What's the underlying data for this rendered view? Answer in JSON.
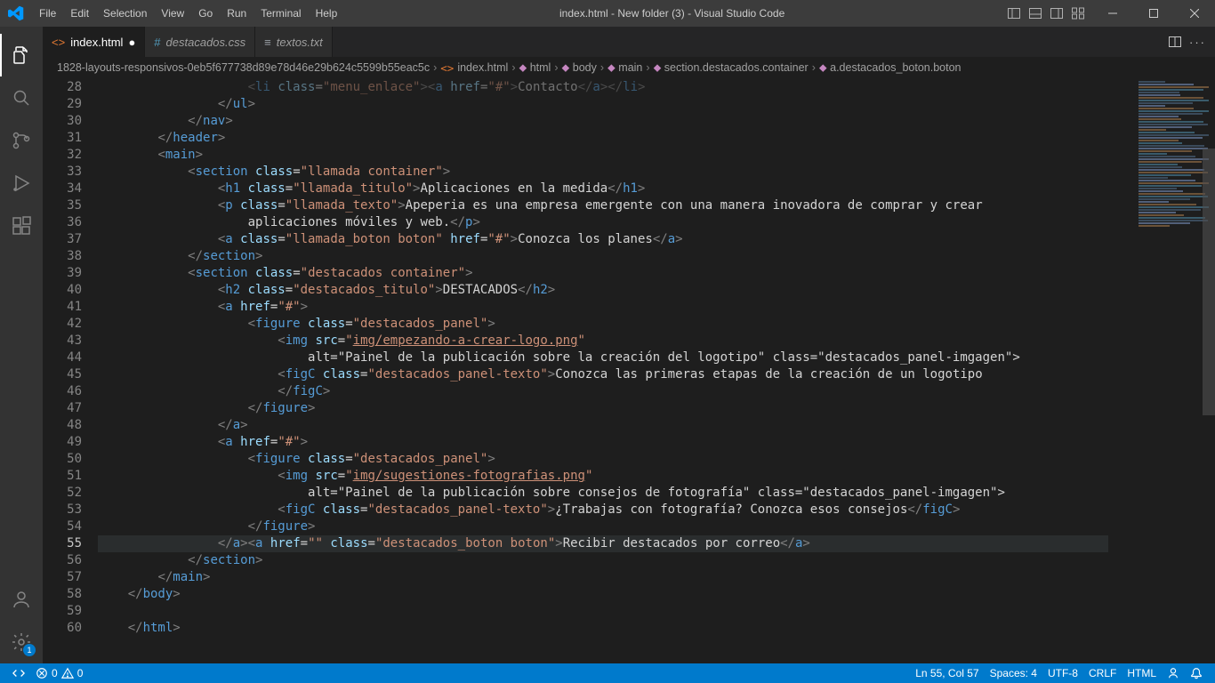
{
  "titlebar": {
    "menu": [
      "File",
      "Edit",
      "Selection",
      "View",
      "Go",
      "Run",
      "Terminal",
      "Help"
    ],
    "title": "index.html - New folder (3) - Visual Studio Code"
  },
  "tabs": [
    {
      "icon": "html",
      "label": "index.html",
      "active": true,
      "dirty": true
    },
    {
      "icon": "css",
      "label": "destacados.css",
      "active": false,
      "dirty": false
    },
    {
      "icon": "txt",
      "label": "textos.txt",
      "active": false,
      "dirty": false
    }
  ],
  "breadcrumb": {
    "folder": "1828-layouts-responsivos-0eb5f677738d89e78d46e29b624c5599b55eac5c",
    "file": "index.html",
    "path": [
      "html",
      "body",
      "main",
      "section.destacados.container",
      "a.destacados_boton.boton"
    ]
  },
  "gutter": {
    "start": 28,
    "end": 60,
    "highlight": 55
  },
  "code_lines": [
    {
      "n": 28,
      "indent": 20,
      "raw": "<li class=\"menu_enlace\"><a href=\"#\">Contacto</a></li>",
      "fade": true
    },
    {
      "n": 29,
      "indent": 16,
      "raw": "</ul>"
    },
    {
      "n": 30,
      "indent": 12,
      "raw": "</nav>"
    },
    {
      "n": 31,
      "indent": 8,
      "raw": "</header>"
    },
    {
      "n": 32,
      "indent": 8,
      "raw": "<main>"
    },
    {
      "n": 33,
      "indent": 12,
      "raw": "<section class=\"llamada container\">"
    },
    {
      "n": 34,
      "indent": 16,
      "raw": "<h1 class=\"llamada_titulo\">Aplicaciones en la medida</h1>"
    },
    {
      "n": 35,
      "indent": 16,
      "raw": "<p class=\"llamada_texto\">Apeperia es una empresa emergente con una manera inovadora de comprar y crear"
    },
    {
      "n": 36,
      "indent": 20,
      "raw": "aplicaciones móviles y web.</p>"
    },
    {
      "n": 37,
      "indent": 16,
      "raw": "<a class=\"llamada_boton boton\" href=\"#\">Conozca los planes</a>"
    },
    {
      "n": 38,
      "indent": 12,
      "raw": "</section>"
    },
    {
      "n": 39,
      "indent": 12,
      "raw": "<section class=\"destacados container\">"
    },
    {
      "n": 40,
      "indent": 16,
      "raw": "<h2 class=\"destacados_titulo\">DESTACADOS</h2>"
    },
    {
      "n": 41,
      "indent": 16,
      "raw": "<a href=\"#\">"
    },
    {
      "n": 42,
      "indent": 20,
      "raw": "<figure class=\"destacados_panel\">"
    },
    {
      "n": 43,
      "indent": 24,
      "raw": "<img src=\"img/empezando-a-crear-logo.png\"",
      "link": "img/empezando-a-crear-logo.png"
    },
    {
      "n": 44,
      "indent": 28,
      "raw": "alt=\"Painel de la publicación sobre la creación del logotipo\" class=\"destacados_panel-imgagen\">"
    },
    {
      "n": 45,
      "indent": 24,
      "raw": "<figC class=\"destacados_panel-texto\">Conozca las primeras etapas de la creación de un logotipo"
    },
    {
      "n": 46,
      "indent": 24,
      "raw": "</figC>"
    },
    {
      "n": 47,
      "indent": 20,
      "raw": "</figure>"
    },
    {
      "n": 48,
      "indent": 16,
      "raw": "</a>"
    },
    {
      "n": 49,
      "indent": 16,
      "raw": "<a href=\"#\">"
    },
    {
      "n": 50,
      "indent": 20,
      "raw": "<figure class=\"destacados_panel\">"
    },
    {
      "n": 51,
      "indent": 24,
      "raw": "<img src=\"img/sugestiones-fotografias.png\"",
      "link": "img/sugestiones-fotografias.png"
    },
    {
      "n": 52,
      "indent": 28,
      "raw": "alt=\"Painel de la publicación sobre consejos de fotografía\" class=\"destacados_panel-imgagen\">"
    },
    {
      "n": 53,
      "indent": 24,
      "raw": "<figC class=\"destacados_panel-texto\">¿Trabajas con fotografía? Conozca esos consejos</figC>"
    },
    {
      "n": 54,
      "indent": 20,
      "raw": "</figure>"
    },
    {
      "n": 55,
      "indent": 16,
      "raw": "</a><a href=\"\" class=\"destacados_boton boton\">Recibir destacados por correo</a>",
      "hl": true
    },
    {
      "n": 56,
      "indent": 12,
      "raw": "</section>"
    },
    {
      "n": 57,
      "indent": 8,
      "raw": "</main>"
    },
    {
      "n": 58,
      "indent": 4,
      "raw": "</body>"
    },
    {
      "n": 59,
      "indent": 0,
      "raw": ""
    },
    {
      "n": 60,
      "indent": 4,
      "raw": "</html>"
    }
  ],
  "status": {
    "errors": "0",
    "warnings": "0",
    "position": "Ln 55, Col 57",
    "spaces": "Spaces: 4",
    "encoding": "UTF-8",
    "eol": "CRLF",
    "lang": "HTML"
  },
  "activity_badge": "1"
}
